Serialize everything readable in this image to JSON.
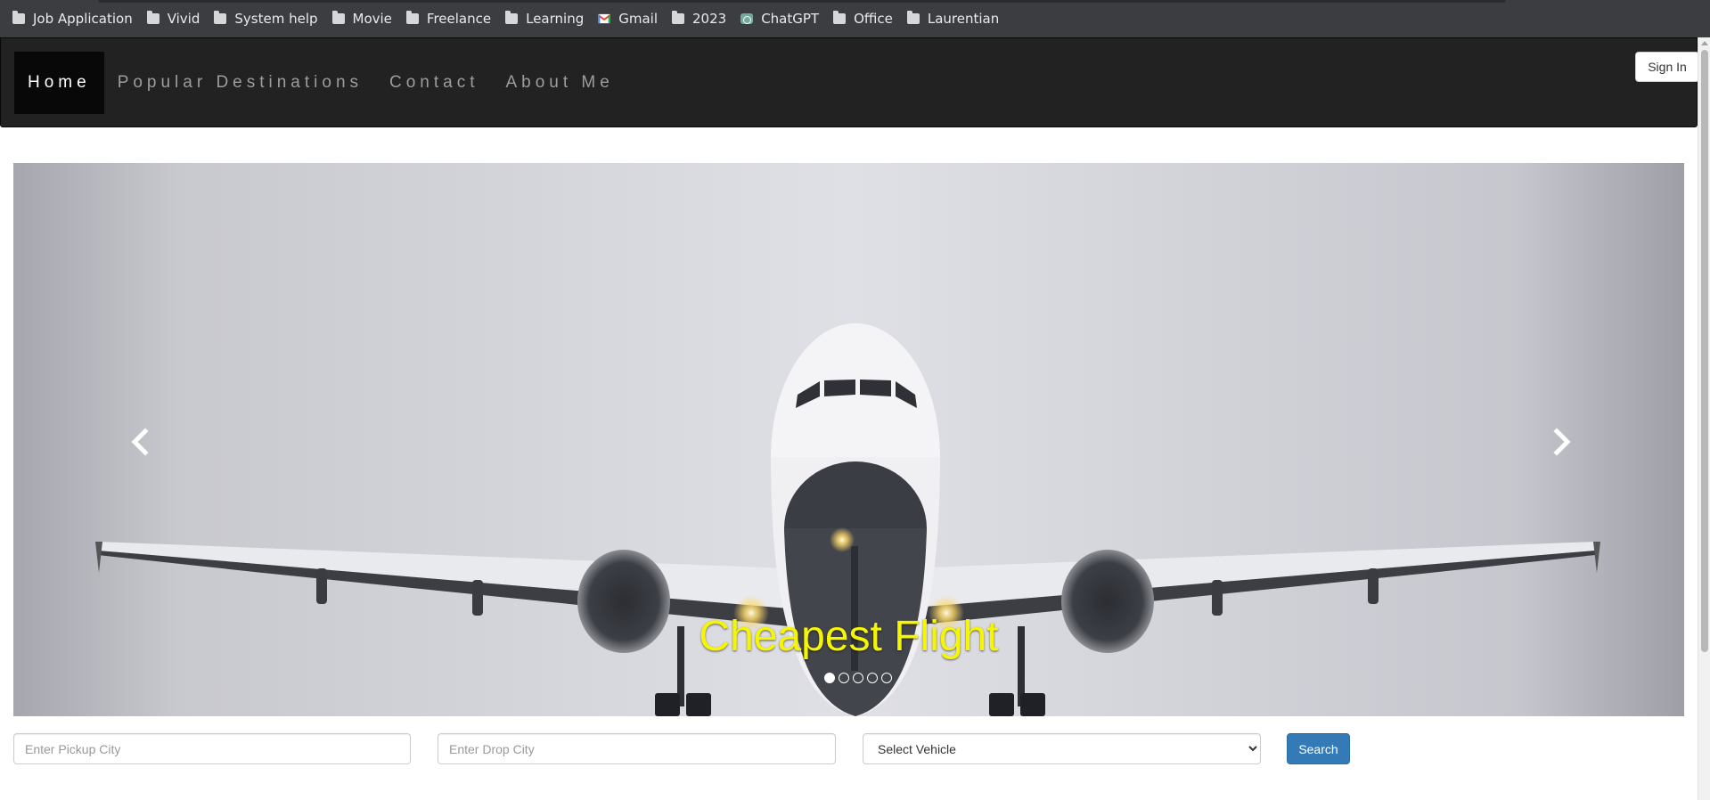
{
  "bookmarks": [
    {
      "label": "Job Application",
      "icon": "folder-icon"
    },
    {
      "label": "Vivid",
      "icon": "folder-icon"
    },
    {
      "label": "System help",
      "icon": "folder-icon"
    },
    {
      "label": "Movie",
      "icon": "folder-icon"
    },
    {
      "label": "Freelance",
      "icon": "folder-icon"
    },
    {
      "label": "Learning",
      "icon": "folder-icon"
    },
    {
      "label": "Gmail",
      "icon": "gmail-icon"
    },
    {
      "label": "2023",
      "icon": "folder-icon"
    },
    {
      "label": "ChatGPT",
      "icon": "chatgpt-icon"
    },
    {
      "label": "Office",
      "icon": "folder-icon"
    },
    {
      "label": "Laurentian",
      "icon": "folder-icon"
    }
  ],
  "nav": {
    "links": [
      {
        "label": "Home",
        "active": true
      },
      {
        "label": "Popular Destinations",
        "active": false
      },
      {
        "label": "Contact",
        "active": false
      },
      {
        "label": "About Me",
        "active": false
      }
    ],
    "signin_label": "Sign In"
  },
  "carousel": {
    "caption": "Cheapest Flight",
    "caption_color": "#f6f600",
    "slide_count": 5,
    "active_slide": 1,
    "prev_icon": "chevron-left-icon",
    "next_icon": "chevron-right-icon"
  },
  "search": {
    "pickup_placeholder": "Enter Pickup City",
    "drop_placeholder": "Enter Drop City",
    "vehicle_selected": "Select Vehicle",
    "button_label": "Search",
    "button_color": "#337ab7"
  }
}
